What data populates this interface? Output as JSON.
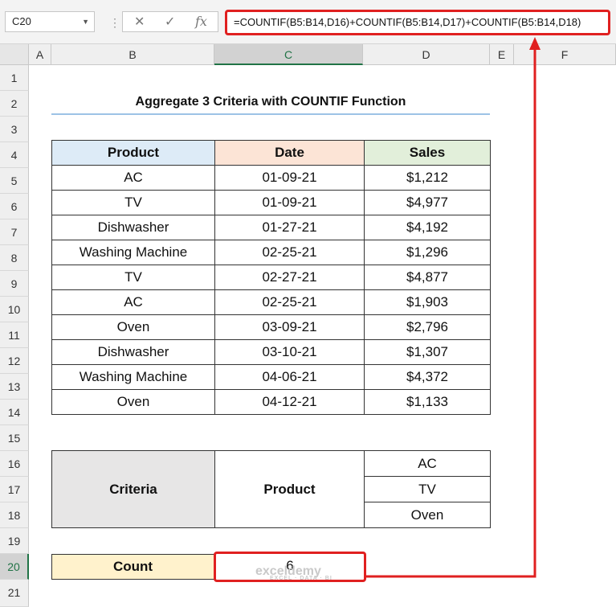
{
  "name_box": "C20",
  "formula_bar": {
    "fx_label": "fx",
    "formula": "=COUNTIF(B5:B14,D16)+COUNTIF(B5:B14,D17)+COUNTIF(B5:B14,D18)"
  },
  "columns": [
    "A",
    "B",
    "C",
    "D",
    "E",
    "F"
  ],
  "rows": [
    "1",
    "2",
    "3",
    "4",
    "5",
    "6",
    "7",
    "8",
    "9",
    "10",
    "11",
    "12",
    "13",
    "14",
    "15",
    "16",
    "17",
    "18",
    "19",
    "20",
    "21"
  ],
  "title": "Aggregate 3 Criteria with COUNTIF Function",
  "table": {
    "headers": [
      "Product",
      "Date",
      "Sales"
    ],
    "rows": [
      [
        "AC",
        "01-09-21",
        "$1,212"
      ],
      [
        "TV",
        "01-09-21",
        "$4,977"
      ],
      [
        "Dishwasher",
        "01-27-21",
        "$4,192"
      ],
      [
        "Washing Machine",
        "02-25-21",
        "$1,296"
      ],
      [
        "TV",
        "02-27-21",
        "$4,877"
      ],
      [
        "AC",
        "02-25-21",
        "$1,903"
      ],
      [
        "Oven",
        "03-09-21",
        "$2,796"
      ],
      [
        "Dishwasher",
        "03-10-21",
        "$1,307"
      ],
      [
        "Washing Machine",
        "04-06-21",
        "$4,372"
      ],
      [
        "Oven",
        "04-12-21",
        "$1,133"
      ]
    ]
  },
  "criteria": {
    "label": "Criteria",
    "field": "Product",
    "values": [
      "AC",
      "TV",
      "Oven"
    ]
  },
  "count": {
    "label": "Count",
    "value": "6"
  },
  "watermark": {
    "brand": "exceldemy",
    "tagline": "EXCEL · DATA · BI"
  },
  "colors": {
    "accent_red": "#e02020",
    "excel_green": "#217346",
    "product_header": "#ddebf7",
    "date_header": "#fce4d6",
    "sales_header": "#e2efda",
    "criteria_bg": "#e7e6e6",
    "count_bg": "#fff2cc"
  }
}
